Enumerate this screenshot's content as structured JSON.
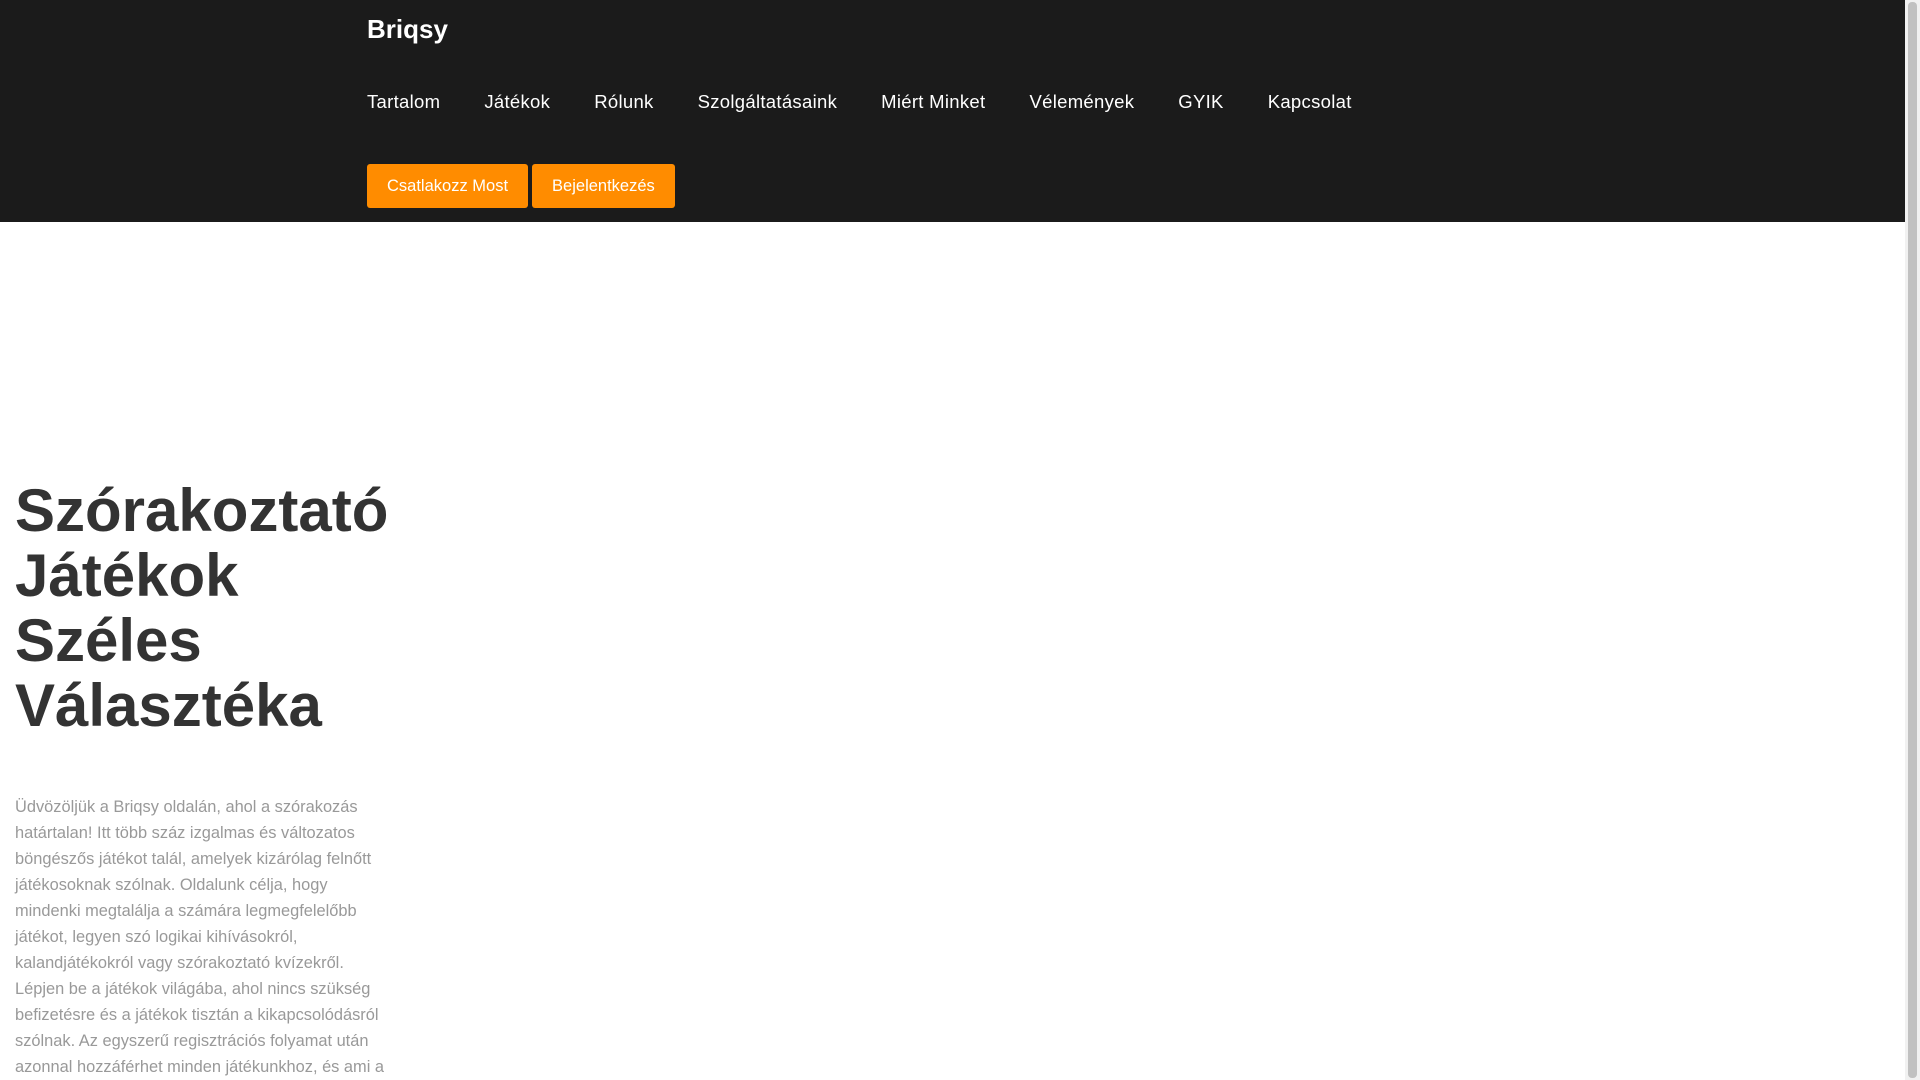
{
  "header": {
    "brand": "Briqsy",
    "nav": [
      "Tartalom",
      "Játékok",
      "Rólunk",
      "Szolgáltatásaink",
      "Miért Minket",
      "Vélemények",
      "GYIK",
      "Kapcsolat"
    ],
    "join_button": "Csatlakozz Most",
    "login_button": "Bejelentkezés"
  },
  "hero": {
    "title": "Szórakoztató Játékok Széles Választéka",
    "text": "Üdvözöljük a Briqsy oldalán, ahol a szórakozás határtalan! Itt több száz izgalmas és változatos böngészős játékot talál, amelyek kizárólag felnőtt játékosoknak szólnak. Oldalunk célja, hogy mindenki megtalálja a számára legmegfelelőbb játékot, legyen szó logikai kihívásokról, kalandjátékokról vagy szórakoztató kvízekről. Lépjen be a játékok világába, ahol nincs szükség befizetésre és a játékok tisztán a kikapcsolódásról szólnak. Az egyszerű regisztrációs folyamat után azonnal hozzáférhet minden játékunkhoz, és ami a"
  },
  "colors": {
    "accent": "#ff8c00",
    "header_bg": "#1b1b1b"
  }
}
